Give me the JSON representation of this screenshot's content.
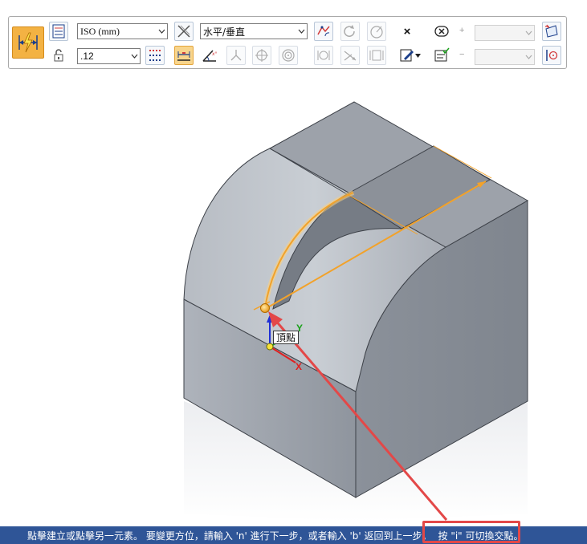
{
  "toolbar": {
    "standard_value": "ISO (mm)",
    "precision_value": ".12",
    "orientation_value": "水平/垂直",
    "clear_symbol": "×",
    "plus_sign": "+",
    "minus_sign": "−",
    "accent_color": "#f3b243",
    "icons": [
      "smart-dimension-icon",
      "dimension-style-icon",
      "lock-icon",
      "dimension-grid-icon",
      "distance-between-icon",
      "linear-dimension-icon",
      "angle-dimension-icon",
      "angle-between-icon",
      "symmetric-diameter-icon",
      "arc-dimension-icon",
      "concentric-icon",
      "orientation-axis-icon",
      "radius-icon",
      "circle-diameter-icon",
      "coordinate-dimension-icon",
      "angular-coordinate-icon",
      "chamfer-dimension-icon",
      "clear-icon",
      "edit-formula-icon",
      "dimension-template-icon",
      "tolerance-icon",
      "stack-icon",
      "plane-icon",
      "hole-reference-icon"
    ]
  },
  "viewport": {
    "vertex_tooltip": "頂點",
    "axis_y": "Y",
    "axis_x": "X"
  },
  "status_bar": {
    "message": "點擊建立或點擊另一元素。 要變更方位，請輸入 'n' 進行下一步，或者輸入 'b' 返回到上一步。",
    "hint": "按 \"i\" 可切換交點。",
    "background": "#2f5597",
    "callout_color": "#e34848"
  }
}
